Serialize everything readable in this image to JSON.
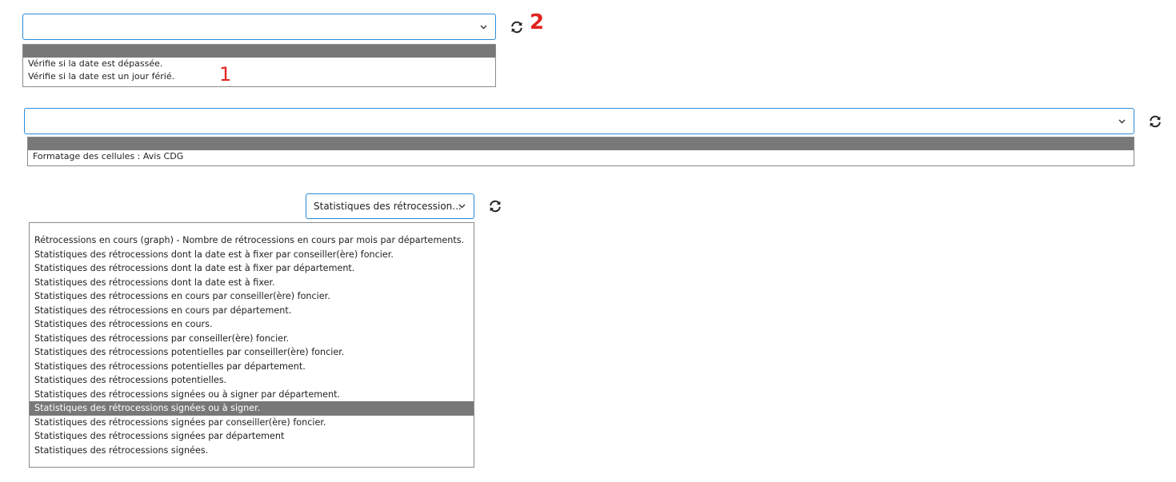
{
  "select1": {
    "value": "",
    "options": [
      "",
      "Vérifie si la date est dépassée.",
      "Vérifie si la date est un jour férié."
    ]
  },
  "select2": {
    "value": "",
    "options": [
      "",
      "Formatage des cellules : Avis CDG"
    ]
  },
  "select3": {
    "value": "Statistiques des rétrocession...",
    "options": [
      "",
      "Rétrocessions en cours (graph) - Nombre de rétrocessions en cours par mois par départements.",
      "Statistiques des rétrocessions dont la date est à fixer par conseiller(ère) foncier.",
      "Statistiques des rétrocessions dont la date est à fixer par département.",
      "Statistiques des rétrocessions dont la date est à fixer.",
      "Statistiques des rétrocessions en cours par conseiller(ère) foncier.",
      "Statistiques des rétrocessions en cours par département.",
      "Statistiques des rétrocessions en cours.",
      "Statistiques des rétrocessions par conseiller(ère) foncier.",
      "Statistiques des rétrocessions potentielles par conseiller(ère) foncier.",
      "Statistiques des rétrocessions potentielles par département.",
      "Statistiques des rétrocessions potentielles.",
      "Statistiques des rétrocessions signées ou à signer par département.",
      "Statistiques des rétrocessions signées ou à signer.",
      "Statistiques des rétrocessions signées par conseiller(ère) foncier.",
      "Statistiques des rétrocessions signées par département",
      "Statistiques des rétrocessions signées."
    ],
    "selected_option": "Statistiques des rétrocessions signées ou à signer."
  },
  "annotations": {
    "label_1": "1",
    "label_2": "2",
    "color": "#e0231f"
  },
  "icons": {
    "refresh": "refresh-icon",
    "chevron": "chevron-down-icon"
  }
}
